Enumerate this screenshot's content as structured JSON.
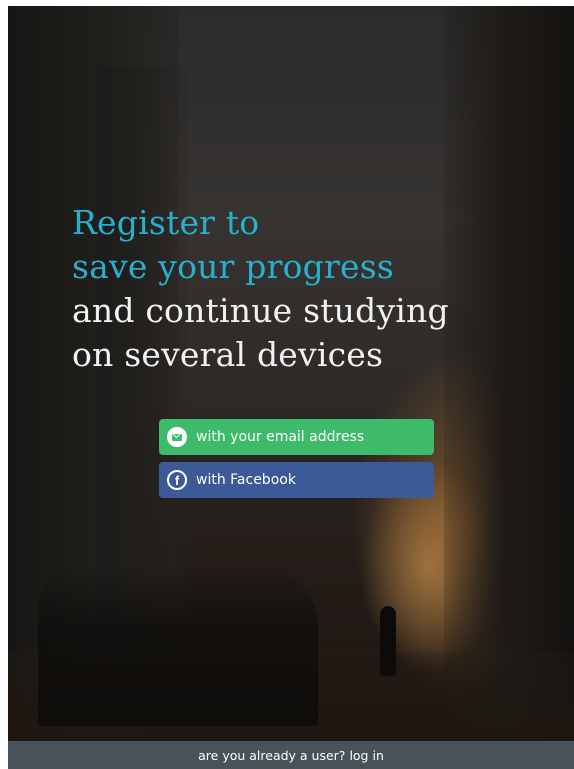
{
  "headline": {
    "line1": "Register to",
    "line2": "save your progress",
    "line3": "and continue studying",
    "line4": "on several devices"
  },
  "buttons": {
    "email_label": "with your email address",
    "facebook_label": "with Facebook"
  },
  "footer": {
    "prompt": "are you already a user?",
    "login_label": "log in"
  },
  "icons": {
    "email": "envelope-icon",
    "facebook": "facebook-icon"
  },
  "colors": {
    "accent": "#27b0cf",
    "email_button": "#3dbb6a",
    "facebook_button": "#3d5a98",
    "footer_bar": "#47525a"
  }
}
